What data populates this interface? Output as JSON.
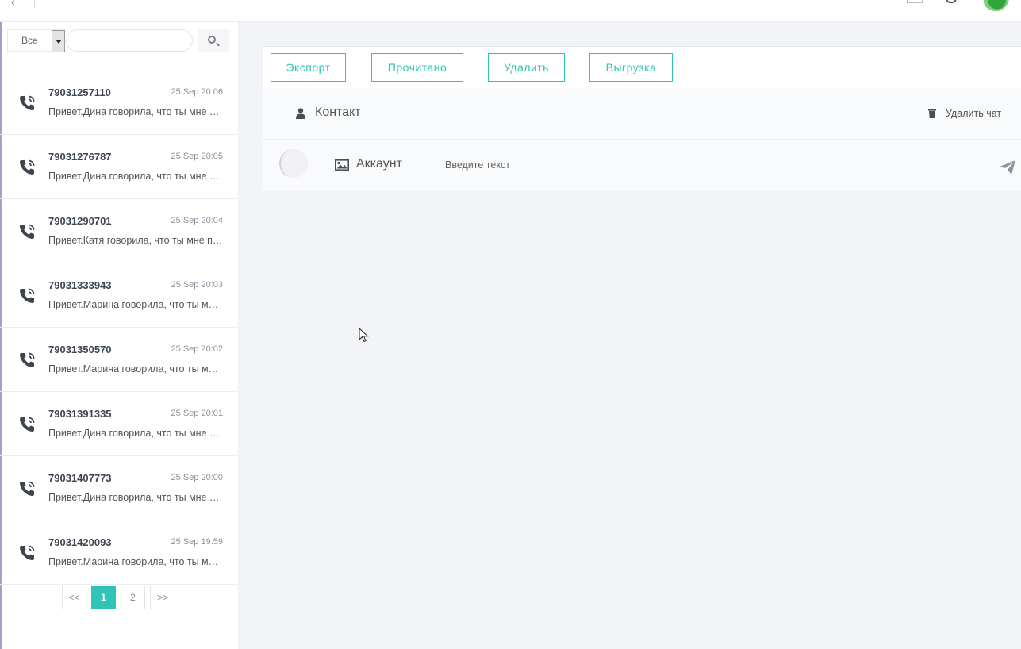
{
  "filter": {
    "selected": "Все",
    "search_value": "",
    "search_placeholder": ""
  },
  "chats": [
    {
      "number": "79031257110",
      "time": "25 Sep 20:06",
      "message": "Привет.Дина говорила, что ты мне поможешь"
    },
    {
      "number": "79031276787",
      "time": "25 Sep 20:05",
      "message": "Привет.Дина говорила, что ты мне поможешь"
    },
    {
      "number": "79031290701",
      "time": "25 Sep 20:04",
      "message": "Привет.Катя говорила, что ты мне поможешь"
    },
    {
      "number": "79031333943",
      "time": "25 Sep 20:03",
      "message": "Привет.Марина говорила, что ты мне поможешь"
    },
    {
      "number": "79031350570",
      "time": "25 Sep 20:02",
      "message": "Привет.Марина говорила, что ты мне поможешь"
    },
    {
      "number": "79031391335",
      "time": "25 Sep 20:01",
      "message": "Привет.Дина говорила, что ты мне поможешь"
    },
    {
      "number": "79031407773",
      "time": "25 Sep 20:00",
      "message": "Привет.Дина говорила, что ты мне поможешь"
    },
    {
      "number": "79031420093",
      "time": "25 Sep 19:59",
      "message": "Привет.Марина говорила, что ты мне поможешь"
    }
  ],
  "pagination": {
    "prev": "<<",
    "pages": [
      "1",
      "2"
    ],
    "current": "1",
    "next": ">>"
  },
  "toolbar": {
    "export_label": "Экспорт",
    "read_label": "Прочитано",
    "delete_label": "Удалить",
    "upload_label": "Выгрузка"
  },
  "contact": {
    "label": "Контакт",
    "delete_chat_label": "Удалить чат"
  },
  "compose": {
    "account_label": "Аккаунт",
    "message_placeholder": "Введите текст",
    "message_value": ""
  },
  "colors": {
    "accent": "#2ec5b7",
    "icon": "#3d4552"
  },
  "icons": {
    "chat_item": "phone-call-icon",
    "search": "search-icon",
    "contact": "user-icon",
    "delete_chat": "trash-icon",
    "account": "image-icon",
    "send": "send-icon"
  }
}
